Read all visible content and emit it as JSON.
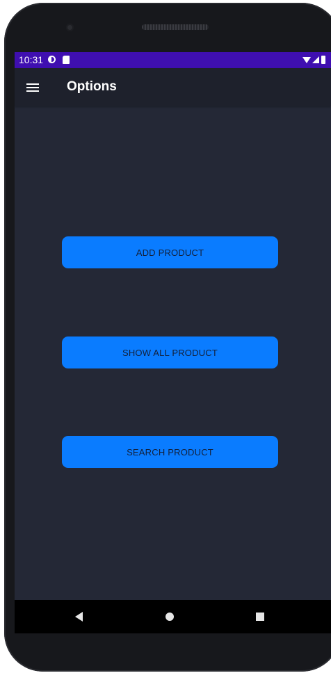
{
  "status_bar": {
    "time": "10:31"
  },
  "app_bar": {
    "title": "Options",
    "menu_icon": "hamburger-menu-icon"
  },
  "buttons": {
    "add_product": "ADD PRODUCT",
    "show_all_product": "SHOW ALL PRODUCT",
    "search_product": "SEARCH PRODUCT"
  },
  "colors": {
    "status_bar": "#3f0fb0",
    "app_bar": "#1e212c",
    "screen_background": "#242836",
    "button": "#0a7cff",
    "button_text": "#13203a"
  },
  "nav_bar": {
    "icons": [
      "back-icon",
      "home-icon",
      "recents-icon"
    ]
  }
}
